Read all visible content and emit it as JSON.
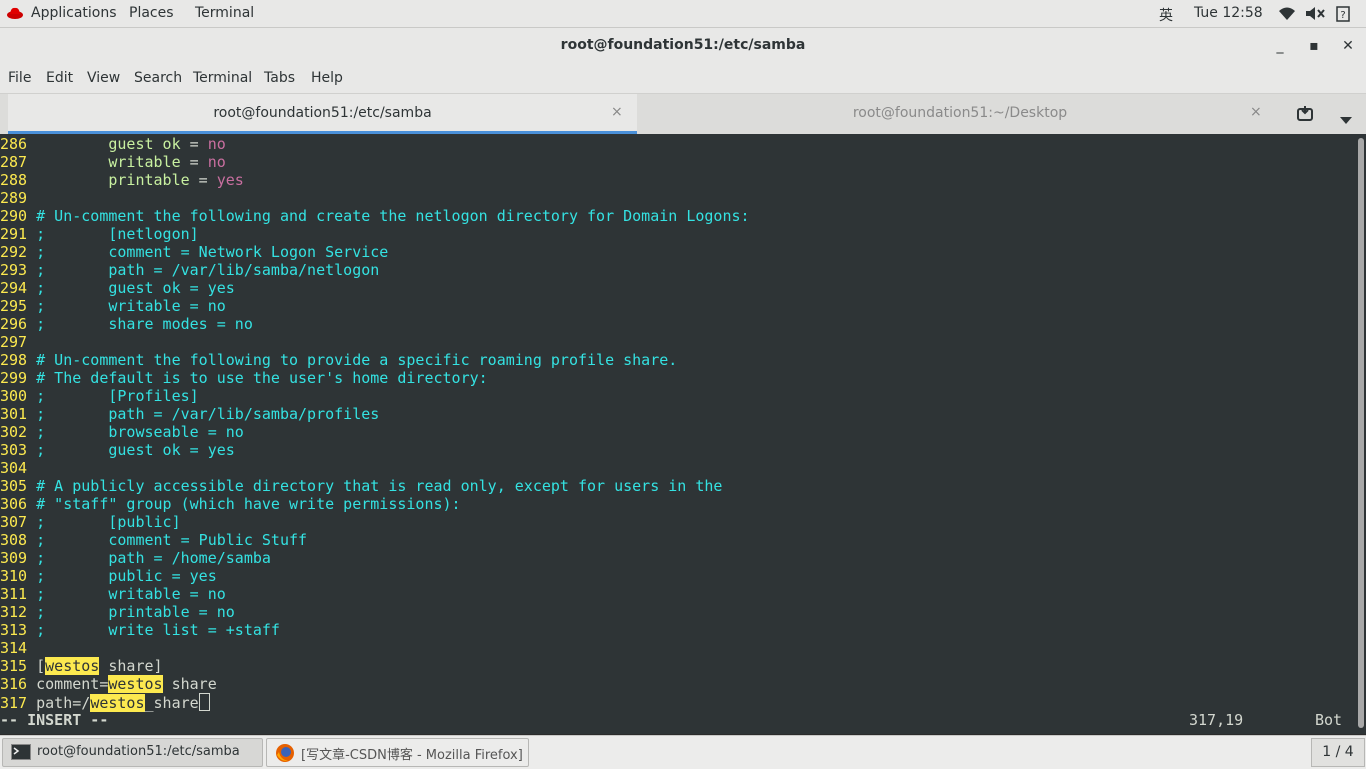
{
  "topbar": {
    "applications": "Applications",
    "places": "Places",
    "terminal": "Terminal",
    "input_method": "英",
    "clock": "Tue 12:58",
    "icons": [
      "redhat-icon",
      "wifi-icon",
      "volume-icon",
      "help-icon"
    ]
  },
  "window": {
    "title": "root@foundation51:/etc/samba",
    "minimize": "_",
    "maximize": "▪",
    "close": "✕"
  },
  "menu": {
    "file": "File",
    "edit": "Edit",
    "view": "View",
    "search": "Search",
    "terminal": "Terminal",
    "tabs": "Tabs",
    "help": "Help"
  },
  "tabs": [
    {
      "label": "root@foundation51:/etc/samba",
      "close": "×",
      "active": true
    },
    {
      "label": "root@foundation51:~/Desktop",
      "close": "×",
      "active": false
    }
  ],
  "editor": {
    "lines": [
      {
        "n": "286",
        "t": "        guest ok = no"
      },
      {
        "n": "287",
        "t": "        writable = no"
      },
      {
        "n": "288",
        "t": "        printable = yes"
      },
      {
        "n": "289",
        "t": ""
      },
      {
        "n": "290",
        "t": "# Un-comment the following and create the netlogon directory for Domain Logons:"
      },
      {
        "n": "291",
        "t": ";       [netlogon]"
      },
      {
        "n": "292",
        "t": ";       comment = Network Logon Service"
      },
      {
        "n": "293",
        "t": ";       path = /var/lib/samba/netlogon"
      },
      {
        "n": "294",
        "t": ";       guest ok = yes"
      },
      {
        "n": "295",
        "t": ";       writable = no"
      },
      {
        "n": "296",
        "t": ";       share modes = no"
      },
      {
        "n": "297",
        "t": ""
      },
      {
        "n": "298",
        "t": "# Un-comment the following to provide a specific roaming profile share."
      },
      {
        "n": "299",
        "t": "# The default is to use the user's home directory:"
      },
      {
        "n": "300",
        "t": ";       [Profiles]"
      },
      {
        "n": "301",
        "t": ";       path = /var/lib/samba/profiles"
      },
      {
        "n": "302",
        "t": ";       browseable = no"
      },
      {
        "n": "303",
        "t": ";       guest ok = yes"
      },
      {
        "n": "304",
        "t": ""
      },
      {
        "n": "305",
        "t": "# A publicly accessible directory that is read only, except for users in the"
      },
      {
        "n": "306",
        "t": "# \"staff\" group (which have write permissions):"
      },
      {
        "n": "307",
        "t": ";       [public]"
      },
      {
        "n": "308",
        "t": ";       comment = Public Stuff"
      },
      {
        "n": "309",
        "t": ";       path = /home/samba"
      },
      {
        "n": "310",
        "t": ";       public = yes"
      },
      {
        "n": "311",
        "t": ";       writable = no"
      },
      {
        "n": "312",
        "t": ";       printable = no"
      },
      {
        "n": "313",
        "t": ";       write list = +staff"
      },
      {
        "n": "314",
        "t": ""
      },
      {
        "n": "315",
        "t": "[westos share]"
      },
      {
        "n": "316",
        "t": "comment=westos share"
      },
      {
        "n": "317",
        "t": "path=/westos_share"
      }
    ],
    "top_lines": {
      "l286": {
        "indent": "        ",
        "key": "guest ok",
        "eq": " = ",
        "val": "no"
      },
      "l287": {
        "indent": "        ",
        "key": "writable",
        "eq": " = ",
        "val": "no"
      },
      "l288": {
        "indent": "        ",
        "key": "printable",
        "eq": " = ",
        "val": "yes"
      }
    },
    "last_lines": {
      "l315": {
        "open": "[",
        "hl": "westos",
        "rest": " share]"
      },
      "l316": {
        "pre": "comment=",
        "hl": "westos",
        "rest": " share"
      },
      "l317": {
        "pre": "path=/",
        "hl": "westos",
        "rest": "_share"
      }
    },
    "mode": "-- INSERT --",
    "position": "317,19",
    "scroll": "Bot"
  },
  "taskbar": {
    "items": [
      {
        "label": "root@foundation51:/etc/samba",
        "icon": "terminal-icon",
        "active": true
      },
      {
        "label": "[写文章-CSDN博客 - Mozilla Firefox]",
        "icon": "firefox-icon",
        "active": false
      }
    ],
    "workspace": "1 / 4"
  },
  "colors": {
    "terminal_bg": "#2e3436",
    "line_number": "#fce94f",
    "comment": "#34e2e2",
    "identifier": "#c8f0a0",
    "value": "#c96fa0",
    "search_highlight": "#fce94f",
    "tab_accent": "#4a90d9"
  }
}
